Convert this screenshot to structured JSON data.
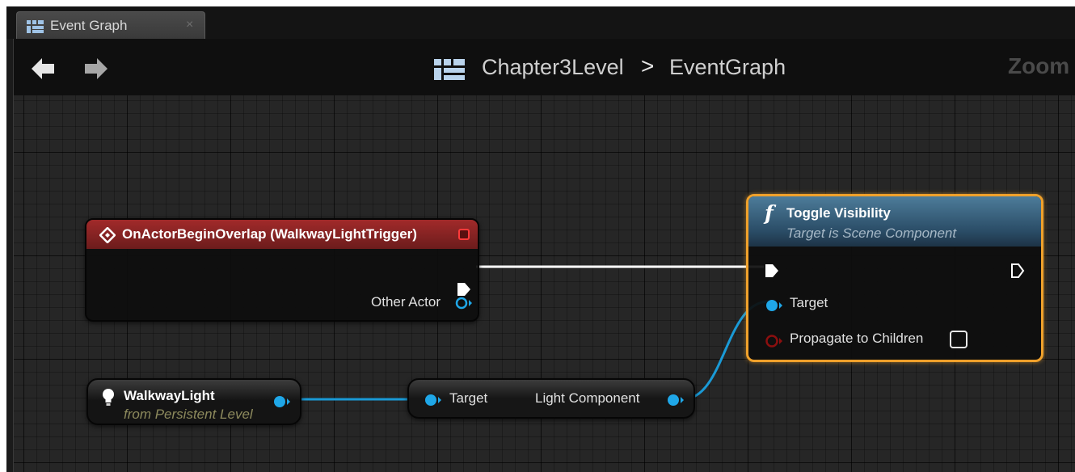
{
  "tab": {
    "title": "Event Graph",
    "close_glyph": "×",
    "icon": "blueprint-graph-icon"
  },
  "header": {
    "breadcrumb_level": "Chapter3Level",
    "breadcrumb_separator": ">",
    "breadcrumb_graph": "EventGraph",
    "zoom_label": "Zoom"
  },
  "nodes": {
    "event": {
      "title": "OnActorBeginOverlap (WalkwayLightTrigger)",
      "output_pin": "Other Actor",
      "header_color": "#8a2424"
    },
    "toggle": {
      "title": "Toggle Visibility",
      "subtitle": "Target is Scene Component",
      "icon_glyph": "f",
      "pins": {
        "target": "Target",
        "propagate": "Propagate to Children"
      },
      "propagate_checked": false,
      "selected_outline_color": "#f0a12b"
    },
    "walkway": {
      "title": "WalkwayLight",
      "subtitle": "from Persistent Level"
    },
    "getter": {
      "input_pin": "Target",
      "output_pin": "Light Component"
    }
  },
  "colors": {
    "object_pin": "#1fa7e8",
    "exec_wire": "#ffffff",
    "bool_pin": "#8b0f0f"
  }
}
